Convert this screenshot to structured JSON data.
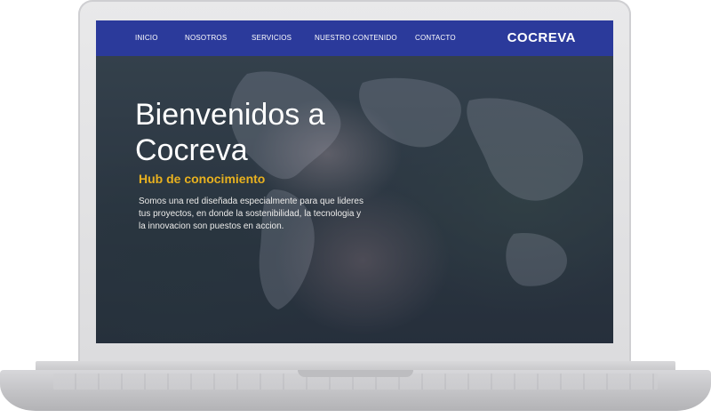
{
  "nav": {
    "items": [
      "INICIO",
      "NOSOTROS",
      "SERVICIOS",
      "NUESTRO CONTENIDO",
      "CONTACTO"
    ],
    "logo": "COCREVA"
  },
  "hero": {
    "title": "Bienvenidos a Cocreva",
    "subtitle": "Hub de conocimiento",
    "description": "Somos una red diseñada especialmente para que lideres tus proyectos, en donde la sostenibilidad, la tecnologia y la innovacion son puestos en accion."
  },
  "colors": {
    "nav_bg": "#2b3a9b",
    "subtitle": "#e8b11f",
    "text": "#ffffff"
  }
}
